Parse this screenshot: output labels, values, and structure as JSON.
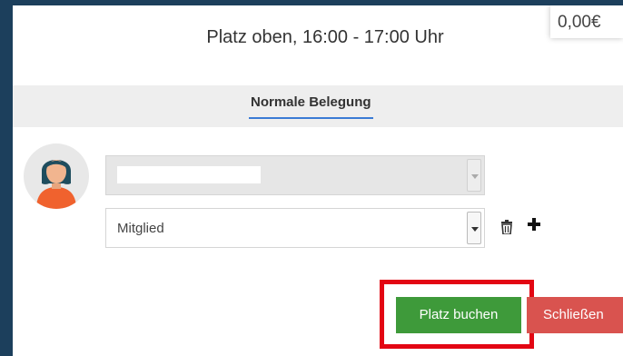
{
  "header": {
    "price": "0,00€",
    "title": "Platz oben, 16:00 - 17:00 Uhr"
  },
  "tabs": [
    {
      "label": "Normale Belegung",
      "active": true
    }
  ],
  "booking": {
    "player_select": {
      "value": "",
      "disabled": true
    },
    "type_select": {
      "value": "Mitglied"
    }
  },
  "icons": {
    "avatar": "female-avatar-icon",
    "delete": "trash-icon",
    "add": "plus-icon"
  },
  "actions": {
    "book_label": "Platz buchen",
    "close_label": "Schließen"
  },
  "colors": {
    "background": "#1c3f5c",
    "book_button": "#3e9a3a",
    "close_button": "#d9534f",
    "highlight": "#e30613",
    "tab_underline": "#3a7bd5"
  }
}
